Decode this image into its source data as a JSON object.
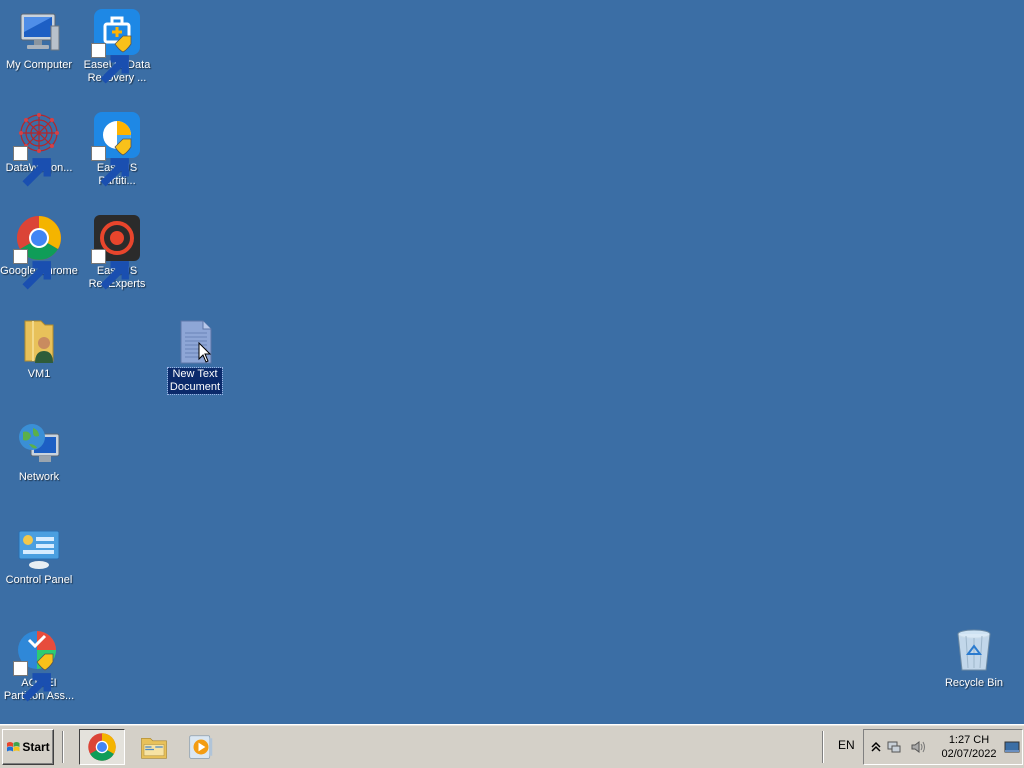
{
  "desktop": {
    "background": "#3b6ea5",
    "icons": [
      {
        "label": "My Computer",
        "icon": "computer-icon"
      },
      {
        "label": "EaseUS Data\nRecovery ...",
        "icon": "easeus-data-recovery-icon"
      },
      {
        "label": "DataWagon...",
        "icon": "datawagon-icon"
      },
      {
        "label": "EaseUS\nPartiti...",
        "icon": "easeus-partition-icon"
      },
      {
        "label": "Google Chrome",
        "icon": "chrome-icon"
      },
      {
        "label": "EaseUS\nRecExperts",
        "icon": "easeus-recexperts-icon"
      },
      {
        "label": "VM1",
        "icon": "user-folder-icon"
      },
      {
        "label": "New Text\nDocument",
        "icon": "text-document-icon",
        "selected": true
      },
      {
        "label": "Network",
        "icon": "network-icon"
      },
      {
        "label": "Control Panel",
        "icon": "control-panel-icon"
      },
      {
        "label": "AOMEI\nPartition Ass...",
        "icon": "aomei-partition-icon"
      },
      {
        "label": "Recycle Bin",
        "icon": "recycle-bin-icon"
      }
    ]
  },
  "taskbar": {
    "start_label": "Start",
    "pinned": [
      {
        "name": "Google Chrome",
        "icon": "chrome-icon"
      },
      {
        "name": "Windows Explorer",
        "icon": "folder-icon"
      },
      {
        "name": "Media Player",
        "icon": "media-player-icon"
      }
    ],
    "language": "EN",
    "clock_time": "1:27 CH",
    "clock_date": "02/07/2022"
  }
}
